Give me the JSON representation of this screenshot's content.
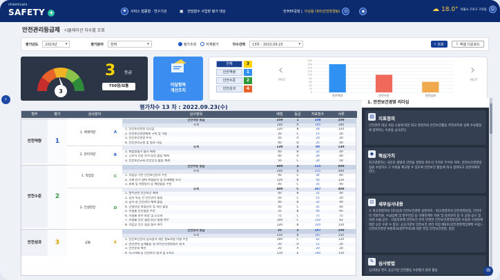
{
  "header": {
    "logo_small": "chemicals",
    "logo_main": "SAFETY",
    "logo_plus": "+",
    "org_label": "서비스 협종형 · 연구기관",
    "notice": "전담협수 사업장 평가 대상",
    "user_info": "전주EP공장 |",
    "user_link": "이상동 대리(안전환경팀)",
    "temperature": "18.0°",
    "location": "서울시 구로구 구로동",
    "icons": [
      "org-icon",
      "notice-icon",
      "user-icon",
      "logout-icon",
      "settings-icon",
      "weather-icon",
      "user-profile-icon"
    ]
  },
  "page": {
    "title": "안전관리등급제",
    "subtitle": "시뮬레이션 차수별 조회"
  },
  "filters": {
    "year_label": "평가년도",
    "year_value": "2023년",
    "field_label": "평가분야",
    "field_value": "전체",
    "radio1": "평가조회",
    "radio2": "자체평가",
    "round_label": "차수선택",
    "round_value": "13차 - 2022.09.23",
    "search_btn": "조회",
    "excel_btn": "엑셀 다운로드"
  },
  "grade_card": {
    "gauge_value": "3",
    "grade": "3",
    "grade_unit": "등급",
    "score": "750점/보통",
    "colors": [
      "#c62d2d",
      "#e8632b",
      "#f0b324",
      "#8bc34a",
      "#2e8b3a"
    ]
  },
  "action_card": {
    "line1": "미달항목",
    "line2": "개선조치"
  },
  "category_chart": {
    "legend": [
      {
        "label": "전체",
        "value": "3"
      },
      {
        "label": "안전역량",
        "value": "1"
      },
      {
        "label": "안전수준",
        "value": "2"
      },
      {
        "label": "안전성과",
        "value": "4"
      }
    ],
    "prev": "PREV",
    "next": "NEXT"
  },
  "chart_data": {
    "type": "bar",
    "categories": [
      "안전역량",
      "안전수준",
      "안전성과"
    ],
    "values": [
      160,
      100,
      60
    ],
    "colors": [
      "#2f92f2",
      "#ef6a5b",
      "#f0a94c"
    ],
    "ylim": [
      0,
      180
    ],
    "yticks": [
      "0",
      "20",
      "40",
      "60",
      "80",
      "100",
      "120",
      "140",
      "160",
      "180"
    ],
    "grid": true
  },
  "period": "평가차수 13 차 : 2022.09.23(수)",
  "table": {
    "headers": [
      "범주",
      "평가",
      "심사분야",
      "심사항목",
      "배점",
      "등급",
      "지표점수",
      "서류"
    ],
    "groups": [
      {
        "cat": "안전역량",
        "grade": "1",
        "color": "#2456c9",
        "areas": [
          {
            "num": "1. 체계역량",
            "letter": "A",
            "rows": [
              [
                "안전역량 등급",
                "250",
                "1",
                "108",
                "250"
              ],
              [
                "소계",
                "100",
                "A",
                "100",
                "300"
              ],
              [
                "1. 안전보건경영 리더십",
                "120",
                "B",
                "28",
                "120"
              ],
              [
                "2. 안전보건경영체계 구축 및 역량",
                "20",
                "C",
                "15",
                "20"
              ],
              [
                "3. 안전보건경영 투자",
                "20",
                "A",
                "20",
                "20"
              ],
              [
                "4. 안전관리규정 및 절차 지침",
                "40",
                "D",
                "35",
                "40"
              ]
            ]
          },
          {
            "num": "2. 관리역량",
            "letter": "B",
            "rows": [
              [
                "소계",
                "130",
                "2",
                "90",
                "130"
              ],
              [
                "1. 위험성평가 실시 체계",
                "40",
                "B",
                "32",
                "40"
              ],
              [
                "2. 근로자 건강 유지·증진 활동 체계",
                "40",
                "A",
                "28",
                "40"
              ],
              [
                "3. 안전보건교육·안전인식 활동 체계",
                "50",
                "C",
                "30",
                "50"
              ]
            ]
          }
        ]
      },
      {
        "cat": "안전수준",
        "grade": "2",
        "color": "#2e9a3a",
        "areas": [
          {
            "num": "1. 작업장",
            "letter": "C",
            "rows": [
              [
                "안전수준 등급",
                "400",
                "3",
                "215",
                "450"
              ],
              [
                "소계",
                "200",
                "B",
                "215",
                "400"
              ],
              [
                "1. 작업장 기본 안전보건관리 수준",
                "40",
                "C",
                "34",
                "40"
              ],
              [
                "2. 기계·전기 설비 위험방지 및 유해예방 조치",
                "120",
                "B",
                "56",
                "120"
              ],
              [
                "3. 화재 및 폭발방지 등 예방활동 수준",
                "40",
                "C",
                "35",
                "40"
              ]
            ]
          },
          {
            "num": "2. 건설현장",
            "letter": "D",
            "rows": [
              [
                "소계",
                "400",
                "C",
                "347",
                "400"
              ],
              [
                "1. 발주관련 안전보건 체계",
                "40",
                "B",
                "32",
                "40"
              ],
              [
                "2. 공사 착공 전 안전관리 활동",
                "20",
                "C",
                "15",
                "20"
              ],
              [
                "3. 공사 중 안전관리 체계 활동",
                "40",
                "B",
                "32",
                "40"
              ],
              [
                "4. 건설현장 위험관리 및 개선 활동",
                "40",
                "C",
                "35",
                "40"
              ],
              [
                "5. 시설물 안전점검 수준",
                "25",
                "B",
                "40",
                "95"
              ],
              [
                "6. 시설물 보수·보강 및 노후화",
                "75",
                "C",
                "75",
                "75"
              ],
              [
                "7. 시설물 안전 점검·진단 실행 여부",
                "100",
                "C",
                "120",
                "62"
              ],
              [
                "8. 작업장 안전 점검 실시 여부",
                "120",
                "B",
                "120",
                "120"
              ]
            ]
          }
        ]
      },
      {
        "cat": "안전성과",
        "grade": "3",
        "color": "#d9a400",
        "areas": [
          {
            "num": "공통",
            "letter": "E",
            "rows": [
              [
                "안전성과 등급",
                "25",
                "3",
                "197",
                "250"
              ],
              [
                "소계",
                "250",
                "B",
                "197",
                "250"
              ],
              [
                "1. 안전보건관리 심사결과 개선 필요사항 이행 수준",
                "300",
                "C",
                "42",
                "120"
              ],
              [
                "2. 안전관련 공개활동 및 외부안전경영평가 결과",
                "20",
                "D",
                "15",
                "20"
              ],
              [
                "3. 안전문화 확산",
                "20",
                "A",
                "20",
                "20"
              ],
              [
                "4. 사고사례 등 안전보건 성과 및 노력도",
                "110",
                "E",
                "100",
                "110"
              ]
            ]
          }
        ]
      }
    ]
  },
  "right_panel": {
    "header": "1. 안전보건경영 리더십",
    "sections": [
      {
        "title": "지표정의",
        "icon": "document-icon",
        "body": "안전관리 대상 사업 시설에 대한 최고 경영자의 안전보건활동 추진의지와 실제 수요활동에 참여하는 수준을 심사한다."
      },
      {
        "title": "핵심가치",
        "icon": "value-icon",
        "body": "최고경영자는 국민의 생명과 안전을 경영의 최우선 가치로 두어야 하며, 안전보건경영방침을 수립하고 그 수준을 제고할 수 있도록 안전보건 활동에 적극 참여하고 실천하여야 한다."
      },
      {
        "title": "세부심사내용",
        "icon": "checklist-icon",
        "body": "① 최고경영자의 리더십과 안전보건경영 실천의지 - 최고경영자의 안전경영방침, 안전조직 역량지원, 수급업체 및 발주현장 등 이해관계자 지원 및 실천의지 등 ② 공정·공시 및 의견·소통·공유 - 사업목표에 안전보건 관리 반영한 안전보건경영방침의 수립과 구성원에 대한 공유 수준 ③ 참고: 공공기관의 안전보건 관리 지침 제6조(안전경영책임계획 수립) - 안전보건경영 위원회의(정부주최)에 대한 현장 안전보건경영, 점검"
      },
      {
        "title": "심사방법",
        "icon": "method-icon",
        "body": "심사대상 연도 공공기관 안전활동 수준평가 결과 활용"
      }
    ]
  }
}
